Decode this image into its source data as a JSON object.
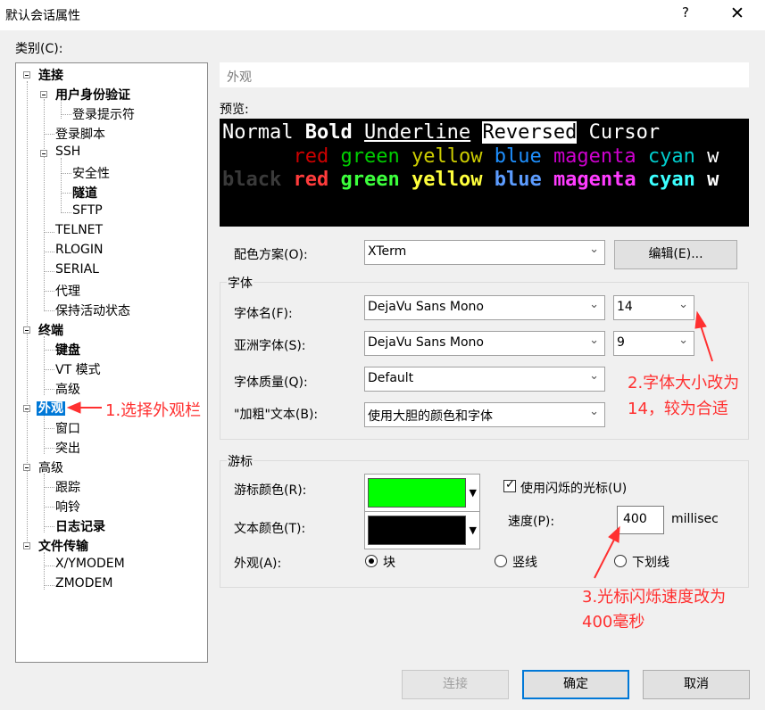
{
  "window": {
    "title": "默认会话属性",
    "help": "?",
    "close": "✕"
  },
  "category_label": "类别(C):",
  "tree": {
    "connection": "连接",
    "user_auth": "用户身份验证",
    "login_prompt": "登录提示符",
    "login_script": "登录脚本",
    "ssh": "SSH",
    "security": "安全性",
    "tunnel": "隧道",
    "sftp": "SFTP",
    "telnet": "TELNET",
    "rlogin": "RLOGIN",
    "serial": "SERIAL",
    "proxy": "代理",
    "keepalive": "保持活动状态",
    "terminal": "终端",
    "keyboard": "键盘",
    "vt_mode": "VT 模式",
    "advanced_term": "高级",
    "appearance": "外观",
    "window": "窗口",
    "highlight": "突出",
    "advanced": "高级",
    "trace": "跟踪",
    "bell": "响铃",
    "logging": "日志记录",
    "file_transfer": "文件传输",
    "xymodem": "X/YMODEM",
    "zmodem": "ZMODEM"
  },
  "section_header": "外观",
  "preview": {
    "label": "预览:",
    "line1": {
      "normal": "Normal",
      "bold": "Bold",
      "underline": "Underline",
      "reversed": "Reversed",
      "cursor": "Cursor"
    },
    "line2": [
      "red",
      "green",
      "yellow",
      "blue",
      "magenta",
      "cyan",
      "w"
    ],
    "line3": [
      "black",
      "red",
      "green",
      "yellow",
      "blue",
      "magenta",
      "cyan",
      "w"
    ],
    "colors": {
      "black": "#3a3a3a",
      "red": "#cd0000",
      "green": "#00cd00",
      "yellow": "#cdcd00",
      "blue": "#1e90ff",
      "magenta": "#cd00cd",
      "cyan": "#00cdcd",
      "bred": "#ff3c3c",
      "bgreen": "#3cff3c",
      "byellow": "#ffff3c",
      "bblue": "#5c9cff",
      "bmagenta": "#ff3cff",
      "bcyan": "#3cffff"
    }
  },
  "color_scheme": {
    "label": "配色方案(O):",
    "value": "XTerm",
    "edit_button": "编辑(E)..."
  },
  "font_group": {
    "title": "字体",
    "font_name_label": "字体名(F):",
    "font_name": "DejaVu Sans Mono",
    "font_size": "14",
    "asian_font_label": "亚洲字体(S):",
    "asian_font": "DejaVu Sans Mono",
    "asian_size": "9",
    "quality_label": "字体质量(Q):",
    "quality": "Default",
    "bold_label": "\"加粗\"文本(B):",
    "bold_value": "使用大胆的颜色和字体"
  },
  "cursor_group": {
    "title": "游标",
    "cursor_color_label": "游标颜色(R):",
    "cursor_color": "#00ff00",
    "text_color_label": "文本颜色(T):",
    "text_color": "#000000",
    "blink_label": "使用闪烁的光标(U)",
    "blink_checked": true,
    "speed_label": "速度(P):",
    "speed_value": "400",
    "speed_unit": "millisec",
    "shape_label": "外观(A):",
    "shape_block": "块",
    "shape_vline": "竖线",
    "shape_underline": "下划线",
    "shape_selected": "块"
  },
  "buttons": {
    "connect": "连接",
    "ok": "确定",
    "cancel": "取消"
  },
  "annotations": {
    "step1": "1.选择外观栏",
    "step2_line1": "2.字体大小改为",
    "step2_line2": "14，较为合适",
    "step3_line1": "3.光标闪烁速度改为",
    "step3_line2": "400毫秒",
    "color": "#ff3030"
  }
}
